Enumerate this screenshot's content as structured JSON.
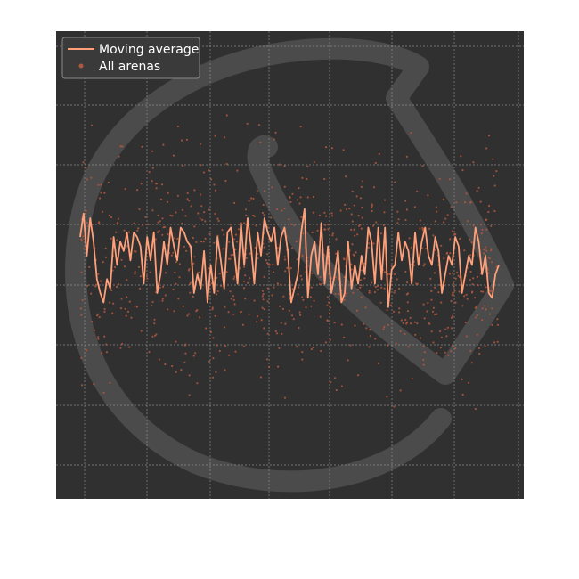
{
  "chart_data": {
    "type": "line",
    "title": "",
    "xlabel": "",
    "ylabel": "",
    "xlim": [
      0,
      250
    ],
    "ylim": [
      0,
      1
    ],
    "grid": true,
    "legend_position": "top-left",
    "background_color": "#303030",
    "page_color": "#ffffff",
    "watermark": "snake-logo",
    "series": [
      {
        "name": "Moving average",
        "kind": "line",
        "color": "#ffa07a",
        "x": [
          0,
          2,
          4,
          6,
          8,
          10,
          12,
          14,
          16,
          18,
          20,
          22,
          24,
          26,
          28,
          30,
          32,
          34,
          36,
          38,
          40,
          42,
          44,
          46,
          48,
          50,
          52,
          54,
          56,
          58,
          60,
          62,
          64,
          66,
          68,
          70,
          72,
          74,
          76,
          78,
          80,
          82,
          84,
          86,
          88,
          90,
          92,
          94,
          96,
          98,
          100,
          102,
          104,
          106,
          108,
          110,
          112,
          114,
          116,
          118,
          120,
          122,
          124,
          126,
          128,
          130,
          132,
          134,
          136,
          138,
          140,
          142,
          144,
          146,
          148,
          150,
          152,
          154,
          156,
          158,
          160,
          162,
          164,
          166,
          168,
          170,
          172,
          174,
          176,
          178,
          180,
          182,
          184,
          186,
          188,
          190,
          192,
          194,
          196,
          198,
          200,
          202,
          204,
          206,
          208,
          210,
          212,
          214,
          216,
          218,
          220,
          222,
          224,
          226,
          228,
          230,
          232,
          234,
          236,
          238,
          240,
          242,
          244,
          246,
          248,
          250
        ],
        "values": [
          0.56,
          0.61,
          0.52,
          0.6,
          0.55,
          0.47,
          0.44,
          0.42,
          0.47,
          0.45,
          0.56,
          0.5,
          0.55,
          0.53,
          0.57,
          0.51,
          0.57,
          0.56,
          0.54,
          0.46,
          0.56,
          0.51,
          0.57,
          0.44,
          0.48,
          0.55,
          0.5,
          0.58,
          0.54,
          0.51,
          0.58,
          0.57,
          0.55,
          0.54,
          0.44,
          0.48,
          0.45,
          0.53,
          0.42,
          0.5,
          0.44,
          0.56,
          0.51,
          0.45,
          0.57,
          0.58,
          0.53,
          0.46,
          0.59,
          0.5,
          0.6,
          0.54,
          0.46,
          0.57,
          0.52,
          0.6,
          0.57,
          0.55,
          0.58,
          0.5,
          0.56,
          0.58,
          0.53,
          0.42,
          0.45,
          0.48,
          0.57,
          0.62,
          0.43,
          0.52,
          0.55,
          0.48,
          0.59,
          0.46,
          0.54,
          0.44,
          0.48,
          0.53,
          0.42,
          0.44,
          0.55,
          0.45,
          0.5,
          0.46,
          0.52,
          0.48,
          0.58,
          0.55,
          0.46,
          0.58,
          0.47,
          0.58,
          0.41,
          0.49,
          0.5,
          0.57,
          0.51,
          0.55,
          0.53,
          0.46,
          0.57,
          0.5,
          0.55,
          0.58,
          0.52,
          0.5,
          0.56,
          0.53,
          0.44,
          0.48,
          0.52,
          0.5,
          0.56,
          0.54,
          0.44,
          0.48,
          0.52,
          0.5,
          0.58,
          0.55,
          0.48,
          0.52,
          0.44,
          0.43,
          0.48,
          0.5
        ]
      },
      {
        "name": "All arenas",
        "kind": "scatter",
        "color": "#b0583e",
        "count": 900,
        "y_range": [
          0.05,
          0.95
        ],
        "y_center": 0.5,
        "y_spread": 0.2
      }
    ]
  }
}
